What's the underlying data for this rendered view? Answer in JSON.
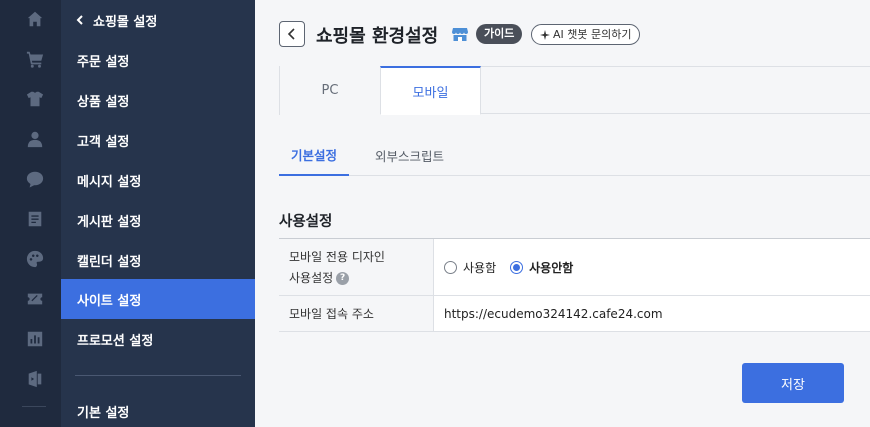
{
  "rail": {
    "icons": [
      "home-icon",
      "cart-icon",
      "shirt-icon",
      "person-icon",
      "chat-icon",
      "document-icon",
      "palette-icon",
      "coupon-icon",
      "chart-icon",
      "app-store-icon"
    ]
  },
  "menu": {
    "header": "쇼핑몰 설정",
    "items": [
      {
        "label": "주문 설정"
      },
      {
        "label": "상품 설정"
      },
      {
        "label": "고객 설정"
      },
      {
        "label": "메시지 설정"
      },
      {
        "label": "게시판 설정"
      },
      {
        "label": "캘린더 설정"
      },
      {
        "label": "사이트 설정"
      },
      {
        "label": "프로모션 설정"
      }
    ],
    "active_item": "사이트 설정",
    "footer_item": "기본 설정"
  },
  "header": {
    "title": "쇼핑몰 환경설정",
    "guide_badge": "가이드",
    "ai_button": "AI 챗봇 문의하기"
  },
  "device_tabs": [
    {
      "label": "PC"
    },
    {
      "label": "모바일"
    }
  ],
  "active_device_tab": "모바일",
  "sub_tabs": [
    {
      "label": "기본설정"
    },
    {
      "label": "외부스크립트"
    }
  ],
  "active_sub_tab": "기본설정",
  "section": {
    "title": "사용설정",
    "rows": [
      {
        "label_line1": "모바일 전용 디자인",
        "label_line2": "사용설정",
        "options": [
          "사용함",
          "사용안함"
        ],
        "selected": "사용안함"
      },
      {
        "label_line1": "모바일 접속 주소",
        "value": "https://ecudemo324142.cafe24.com"
      }
    ]
  },
  "save_button": "저장",
  "colors": {
    "rail_bg": "#1f2a3e",
    "menu_bg": "#26344c",
    "accent": "#3c6fe0"
  }
}
